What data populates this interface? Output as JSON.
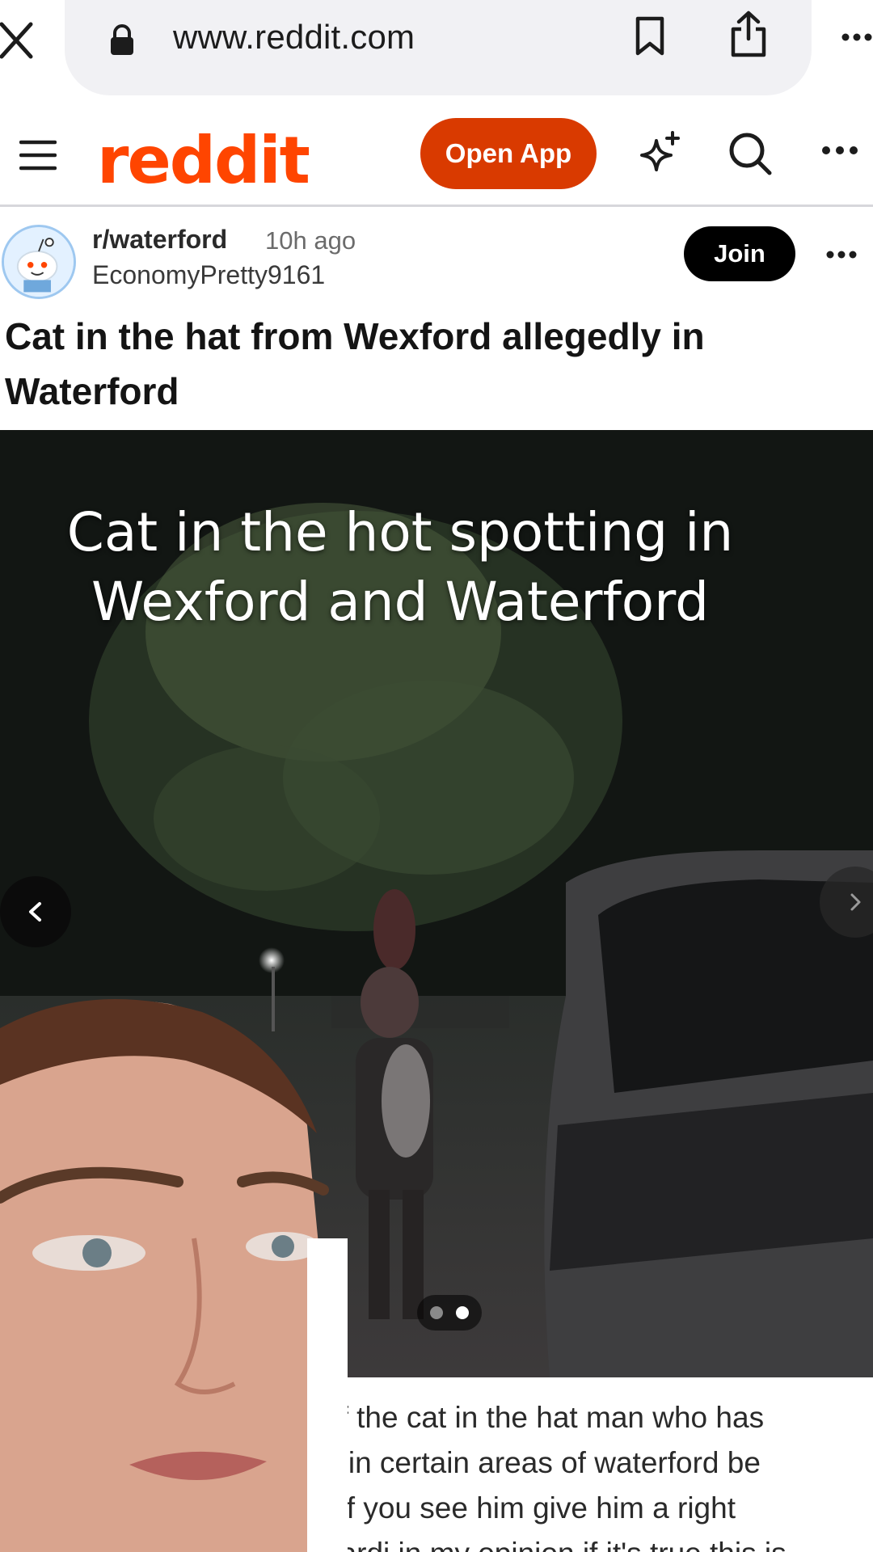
{
  "browser": {
    "url": "www.reddit.com",
    "icons": [
      "close-icon",
      "lock-icon",
      "bookmark-icon",
      "share-icon",
      "more-icon"
    ]
  },
  "header": {
    "logo": "reddit",
    "open_app_label": "Open App",
    "icons": [
      "hamburger-icon",
      "sparkle-icon",
      "search-icon",
      "more-icon"
    ],
    "brand_color": "#ff4500",
    "button_color": "#d93a00"
  },
  "post": {
    "subreddit": "r/waterford",
    "time_ago": "10h ago",
    "author": "EconomyPretty9161",
    "join_label": "Join",
    "title": "Cat in the hat from Wexford allegedly in Waterford",
    "media": {
      "caption": "Cat in the hot spotting in Wexford and Waterford",
      "slides_total": 2,
      "active_slide": 2
    },
    "body_lines": [
      "of the cat in the hat man who has",
      "g in certain areas of waterford be",
      "t if you see him give him a right",
      "uardi in my opinion if it's true this is"
    ]
  }
}
